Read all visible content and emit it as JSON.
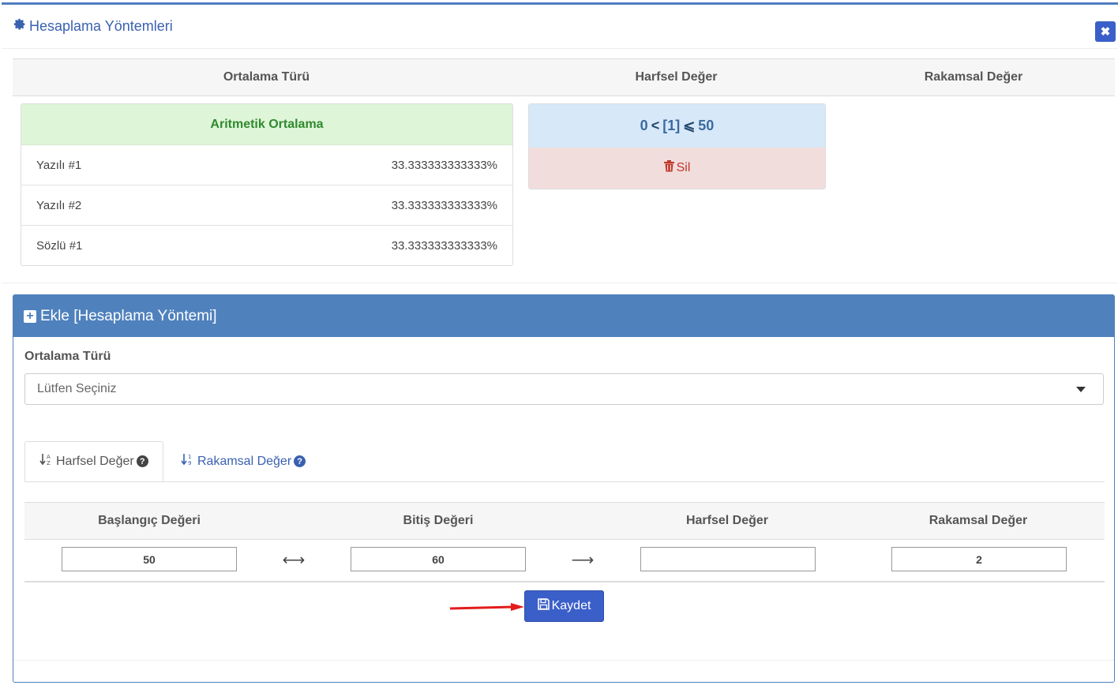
{
  "modal": {
    "title": "Hesaplama Yöntemleri",
    "close_symbol": "✖",
    "title_icon": "gear-icon"
  },
  "summary_table": {
    "headers": [
      "Ortalama Türü",
      "Harfsel Değer",
      "Rakamsal Değer"
    ],
    "avg_type": "Aritmetik Ortalama",
    "rows": [
      {
        "name": "Yazılı #1",
        "value": "33.333333333333%"
      },
      {
        "name": "Yazılı #2",
        "value": "33.333333333333%"
      },
      {
        "name": "Sözlü #1",
        "value": "33.333333333333%"
      }
    ],
    "range": {
      "low": "0",
      "op1": "<",
      "letter": "[1]",
      "op2": "⩽",
      "high": "50",
      "delete_label": "Sil"
    }
  },
  "add_panel": {
    "title": "Ekle [Hesaplama Yöntemi]",
    "avg_type_label": "Ortalama Türü",
    "select_placeholder": "Lütfen Seçiniz",
    "tabs": [
      {
        "label": "Harfsel Değer",
        "active": true
      },
      {
        "label": "Rakamsal Değer",
        "active": false
      }
    ],
    "columns": [
      "Başlangıç Değeri",
      "Bitiş Değeri",
      "Harfsel Değer",
      "Rakamsal Değer"
    ],
    "row": {
      "start": "50",
      "range_arrow": "⟷",
      "end": "60",
      "result_arrow": "⟶",
      "letter": "",
      "number": "2"
    },
    "save_label": "Kaydet"
  },
  "colors": {
    "primary": "#3b5fc9",
    "panel_header": "#4f81bd",
    "success_bg": "#dff5d8",
    "info_bg": "#d7e8f8",
    "danger_bg": "#f2dddd"
  }
}
